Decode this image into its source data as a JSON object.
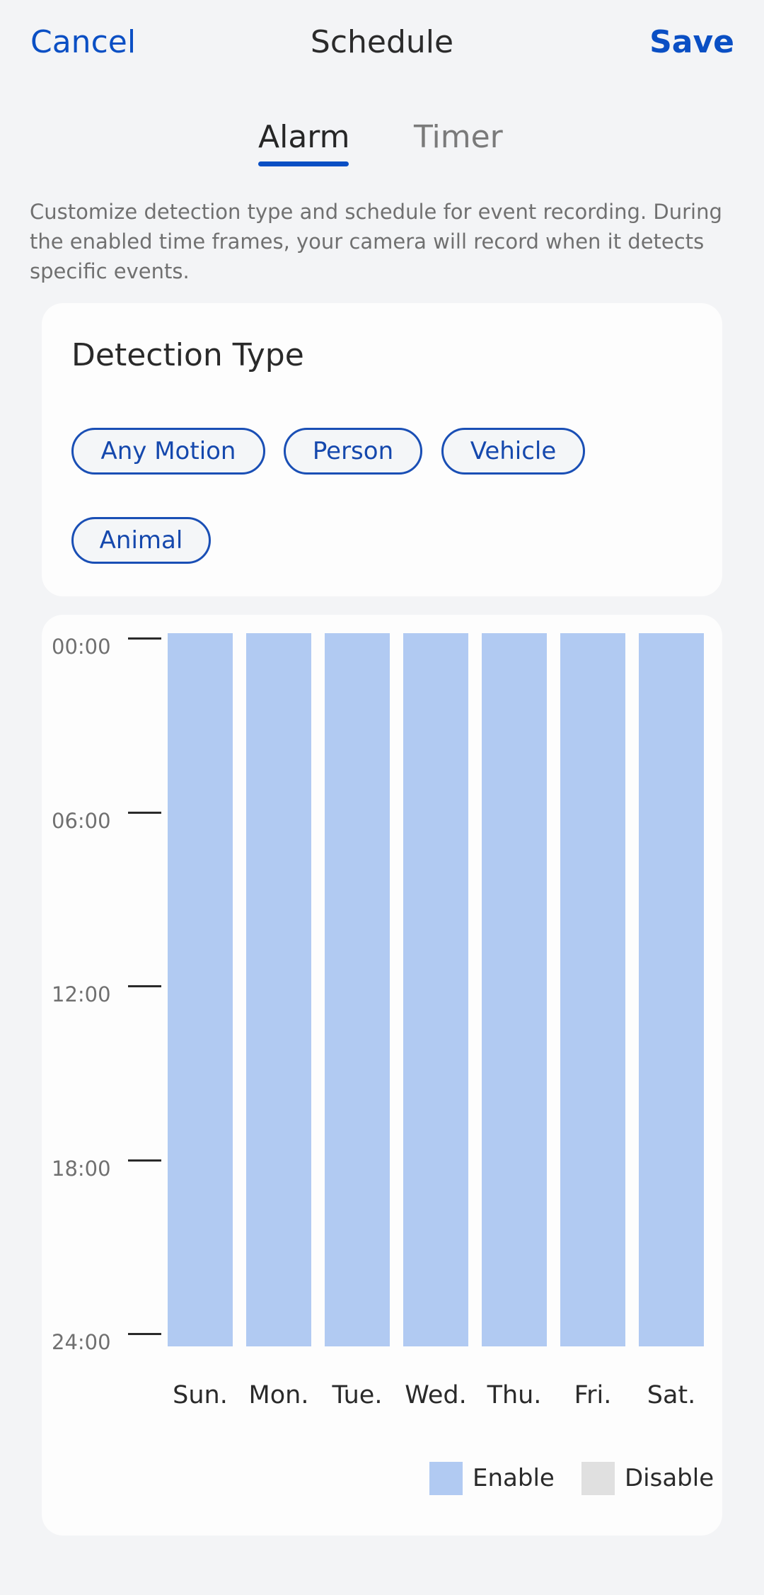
{
  "header": {
    "cancel_label": "Cancel",
    "title": "Schedule",
    "save_label": "Save"
  },
  "tabs": [
    {
      "label": "Alarm",
      "active": true
    },
    {
      "label": "Timer",
      "active": false
    }
  ],
  "description": "Customize detection type and schedule for event recording. During the enabled time frames, your camera will record when it detects specific events.",
  "detection": {
    "title": "Detection Type",
    "chips": [
      "Any Motion",
      "Person",
      "Vehicle",
      "Animal"
    ]
  },
  "colors": {
    "accent": "#0a4fc4",
    "enable": "#b1caf2",
    "disable": "#e0e0e0"
  },
  "chart_data": {
    "type": "bar",
    "title": "",
    "categories": [
      "Sun.",
      "Mon.",
      "Tue.",
      "Wed.",
      "Thu.",
      "Fri.",
      "Sat."
    ],
    "y_ticks": [
      "00:00",
      "06:00",
      "12:00",
      "18:00",
      "24:00"
    ],
    "ylim": [
      0,
      24
    ],
    "y_inverted": true,
    "series": [
      {
        "name": "Enable",
        "color": "#b1caf2",
        "ranges": [
          [
            0,
            24
          ],
          [
            0,
            24
          ],
          [
            0,
            24
          ],
          [
            0,
            24
          ],
          [
            0,
            24
          ],
          [
            0,
            24
          ],
          [
            0,
            24
          ]
        ]
      }
    ],
    "legend": [
      {
        "label": "Enable",
        "color": "#b1caf2"
      },
      {
        "label": "Disable",
        "color": "#e0e0e0"
      }
    ],
    "legend_position": "bottom-right",
    "grid": false
  }
}
